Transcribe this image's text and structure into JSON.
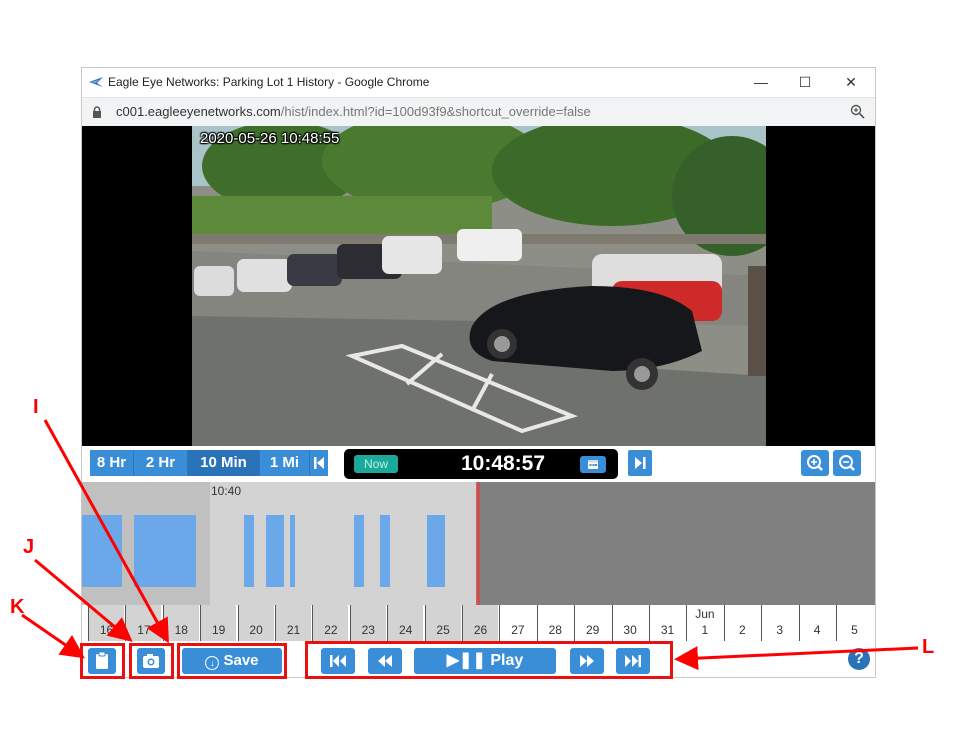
{
  "window": {
    "title": "Eagle Eye Networks: Parking Lot 1 History - Google Chrome",
    "url_host": "c001.eagleeyenetworks.com",
    "url_path": "/hist/index.html?id=100d93f9&shortcut_override=false",
    "controls": {
      "minimize": "—",
      "maximize": "☐",
      "close": "✕"
    }
  },
  "video": {
    "timestamp": "2020-05-26 10:48:55"
  },
  "controls": {
    "ranges": [
      "8 Hr",
      "2 Hr",
      "10 Min",
      "1 Mi"
    ],
    "active_range": "10 Min",
    "now_label": "Now",
    "current_time": "10:48:57"
  },
  "timeline": {
    "label": "10:40",
    "dates": [
      {
        "day": "16"
      },
      {
        "day": "17"
      },
      {
        "day": "18"
      },
      {
        "day": "19"
      },
      {
        "day": "20"
      },
      {
        "day": "21"
      },
      {
        "day": "22"
      },
      {
        "day": "23"
      },
      {
        "day": "24"
      },
      {
        "day": "25"
      },
      {
        "day": "26"
      },
      {
        "day": "27"
      },
      {
        "day": "28"
      },
      {
        "day": "29"
      },
      {
        "day": "30"
      },
      {
        "day": "31"
      },
      {
        "day": "1",
        "month": "Jun"
      },
      {
        "day": "2"
      },
      {
        "day": "3"
      },
      {
        "day": "4"
      },
      {
        "day": "5"
      }
    ]
  },
  "bottom": {
    "save_label": "Save",
    "play_label": "Play",
    "help_label": "?"
  },
  "annotations": {
    "I": "I",
    "J": "J",
    "K": "K",
    "L": "L"
  },
  "colors": {
    "accent": "#3a8ed8",
    "annotation": "#ff0000",
    "now": "#1aa99a"
  }
}
